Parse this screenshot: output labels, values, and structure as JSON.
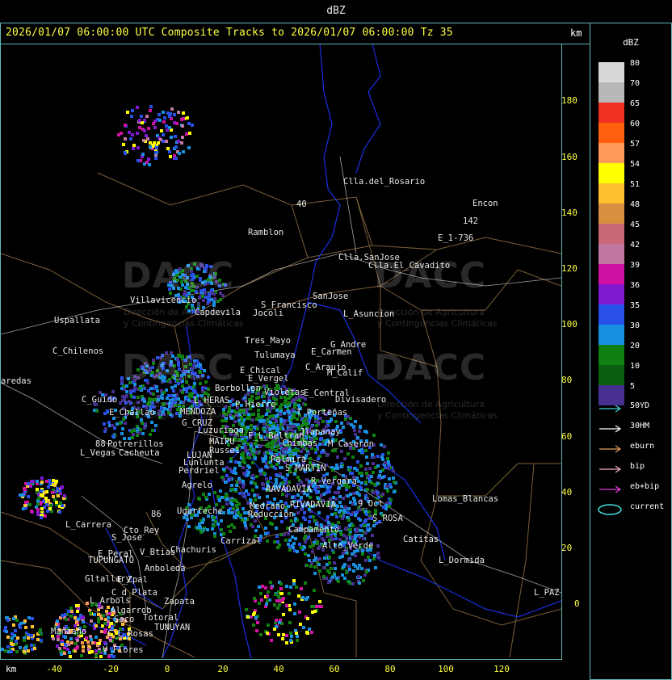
{
  "window": {
    "title": "dBZ"
  },
  "header": {
    "text": "2026/01/07 06:00:00 UTC Composite Tracks to 2026/01/07 06:00:00 Tz 35",
    "units_top": "km",
    "units_bottom": "km"
  },
  "axes": {
    "y_ticks": [
      "180",
      "160",
      "140",
      "120",
      "100",
      "80",
      "60",
      "40",
      "20",
      "0"
    ],
    "x_ticks": [
      "-40",
      "-20",
      "0",
      "20",
      "40",
      "60",
      "80",
      "100",
      "120"
    ]
  },
  "legend": {
    "title": "dBZ",
    "scale": [
      {
        "label": "80",
        "color": "#d8d8d8"
      },
      {
        "label": "70",
        "color": "#b8b8b8"
      },
      {
        "label": "65",
        "color": "#f03020"
      },
      {
        "label": "60",
        "color": "#ff6010"
      },
      {
        "label": "57",
        "color": "#ff9858"
      },
      {
        "label": "54",
        "color": "#ffff00"
      },
      {
        "label": "51",
        "color": "#ffc030"
      },
      {
        "label": "48",
        "color": "#d89040"
      },
      {
        "label": "45",
        "color": "#c86878"
      },
      {
        "label": "42",
        "color": "#c078a0"
      },
      {
        "label": "39",
        "color": "#d010a0"
      },
      {
        "label": "36",
        "color": "#8018d0"
      },
      {
        "label": "35",
        "color": "#2850e8"
      },
      {
        "label": "30",
        "color": "#1890e0"
      },
      {
        "label": "20",
        "color": "#108010"
      },
      {
        "label": "10",
        "color": "#086010"
      },
      {
        "label": "5",
        "color": "#483090"
      }
    ],
    "tracks": [
      {
        "label": "50YD",
        "color": "#40d0d0",
        "shape": "arrow"
      },
      {
        "label": "30HM",
        "color": "#ffffff",
        "shape": "arrow"
      },
      {
        "label": "eburn",
        "color": "#e0a060",
        "shape": "arrow"
      },
      {
        "label": "bip",
        "color": "#f0b0d0",
        "shape": "arrow"
      },
      {
        "label": "eb+bip",
        "color": "#e040e0",
        "shape": "arrow"
      },
      {
        "label": "current",
        "color": "#40e0e0",
        "shape": "ellipse"
      }
    ]
  },
  "watermark": {
    "brand": "DACC",
    "line1": "Dirección de Agricultura",
    "line2": "y Contingencias Climáticas"
  },
  "places": [
    {
      "name": "Clla.del_Rosario"
    },
    {
      "name": "Encon"
    },
    {
      "name": "142"
    },
    {
      "name": "E_1-736"
    },
    {
      "name": "Ramblon"
    },
    {
      "name": "Clla.SanJose"
    },
    {
      "name": "Clla.El_Cavadito"
    },
    {
      "name": "Villavicencio"
    },
    {
      "name": "Capdevila"
    },
    {
      "name": "S_Francisco"
    },
    {
      "name": "Jocoli"
    },
    {
      "name": "SanJose"
    },
    {
      "name": "L_Asuncion"
    },
    {
      "name": "Uspallata"
    },
    {
      "name": "Tres_Mayo"
    },
    {
      "name": "G_Andre"
    },
    {
      "name": "E_Carmen"
    },
    {
      "name": "C_Chilenos"
    },
    {
      "name": "Tulumaya"
    },
    {
      "name": "C_Araujo"
    },
    {
      "name": "M_Calif"
    },
    {
      "name": "E_Chical"
    },
    {
      "name": "E_Vergel"
    },
    {
      "name": "aredas"
    },
    {
      "name": "Borbollon"
    },
    {
      "name": "Violetas"
    },
    {
      "name": "E_Central"
    },
    {
      "name": "Divisadero"
    },
    {
      "name": "L_HERAS"
    },
    {
      "name": "P_Hierro"
    },
    {
      "name": "C_Guido"
    },
    {
      "name": "E_Challao"
    },
    {
      "name": "MENDOZA"
    },
    {
      "name": "T_Porteñas"
    },
    {
      "name": "G_CRUZ"
    },
    {
      "name": "Luzuriaga"
    },
    {
      "name": "F_L_Beltran"
    },
    {
      "name": "Jlapanay"
    },
    {
      "name": "MAIPU"
    },
    {
      "name": "Chimbas"
    },
    {
      "name": "M_Caseron"
    },
    {
      "name": "Potrerillos"
    },
    {
      "name": "Russel"
    },
    {
      "name": "L_Vegas"
    },
    {
      "name": "Cacheuta"
    },
    {
      "name": "LUJAN"
    },
    {
      "name": "Lunlunta"
    },
    {
      "name": "Palmira"
    },
    {
      "name": "S_MARTIN"
    },
    {
      "name": "Perdriel"
    },
    {
      "name": "R_Vergara"
    },
    {
      "name": "Agrelo"
    },
    {
      "name": "RAVADAVIA"
    },
    {
      "name": "Medrano"
    },
    {
      "name": "Reducción"
    },
    {
      "name": "RIVADAVIA"
    },
    {
      "name": "Lomas_Blancas"
    },
    {
      "name": "Ugarteche"
    },
    {
      "name": "9_Oct"
    },
    {
      "name": "S_ROSA"
    },
    {
      "name": "L_Carrera"
    },
    {
      "name": "Cto_Rey"
    },
    {
      "name": "Carrizal"
    },
    {
      "name": "Campamento"
    },
    {
      "name": "Catitas"
    },
    {
      "name": "S_Jose"
    },
    {
      "name": "Chachuris"
    },
    {
      "name": "V_Btias"
    },
    {
      "name": "E_Peral"
    },
    {
      "name": "TUPUNGATO"
    },
    {
      "name": "Alto_Verde"
    },
    {
      "name": "L_Dormida"
    },
    {
      "name": "Anboleda"
    },
    {
      "name": "Gltallary"
    },
    {
      "name": "E_Zpal"
    },
    {
      "name": "L_PAZ"
    },
    {
      "name": "C_d_Plata"
    },
    {
      "name": "L_Arbols"
    },
    {
      "name": "Zapata"
    },
    {
      "name": "Algarrob"
    },
    {
      "name": "Seco"
    },
    {
      "name": "Totoral"
    },
    {
      "name": "TUNUYAN"
    },
    {
      "name": "Manzano"
    },
    {
      "name": "C_L_Rosas"
    },
    {
      "name": "V_Flores"
    },
    {
      "name": "40"
    },
    {
      "name": "88"
    },
    {
      "name": "86"
    }
  ]
}
